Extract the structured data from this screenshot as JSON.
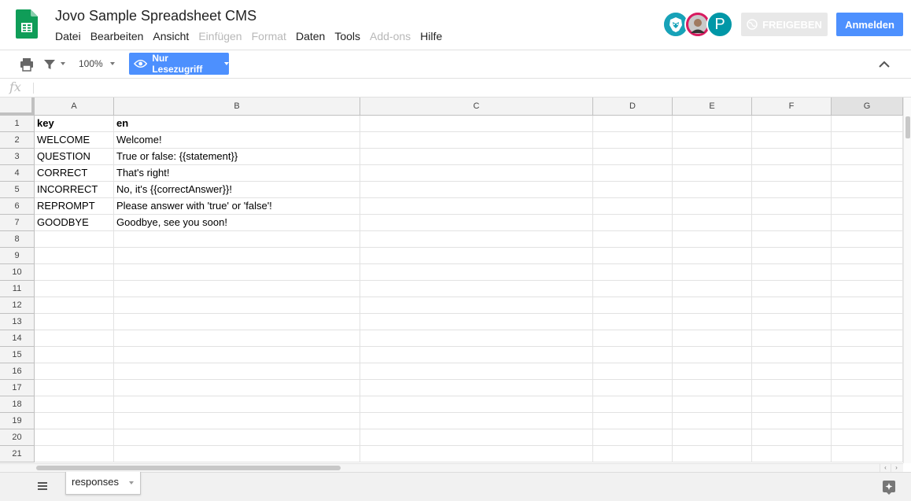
{
  "app": {
    "doc_title": "Jovo Sample Spreadsheet CMS",
    "brand_color": "#0f9d58"
  },
  "menu": [
    {
      "label": "Datei",
      "enabled": true
    },
    {
      "label": "Bearbeiten",
      "enabled": true
    },
    {
      "label": "Ansicht",
      "enabled": true
    },
    {
      "label": "Einfügen",
      "enabled": false
    },
    {
      "label": "Format",
      "enabled": false
    },
    {
      "label": "Daten",
      "enabled": true
    },
    {
      "label": "Tools",
      "enabled": true
    },
    {
      "label": "Add-ons",
      "enabled": false
    },
    {
      "label": "Hilfe",
      "enabled": true
    }
  ],
  "header": {
    "avatars": [
      "lion-avatar",
      "person-photo-avatar",
      "P"
    ],
    "share_label": "FREIGEBEN",
    "login_label": "Anmelden",
    "login_color": "#4d90fe"
  },
  "toolbar": {
    "icons": [
      "print-icon",
      "filter-icon",
      "chevron-up-icon"
    ],
    "zoom": "100%",
    "view_mode_label": "Nur Lesezugriff"
  },
  "formula_bar": {
    "fx_label": "fx",
    "value": ""
  },
  "grid": {
    "columns": [
      "A",
      "B",
      "C",
      "D",
      "E",
      "F",
      "G"
    ],
    "selected_column": "G",
    "rows": [
      {
        "num": "1",
        "cells": [
          "key",
          "en"
        ],
        "bold": true
      },
      {
        "num": "2",
        "cells": [
          "WELCOME",
          "Welcome!"
        ]
      },
      {
        "num": "3",
        "cells": [
          "QUESTION",
          "True or false: {{statement}}"
        ]
      },
      {
        "num": "4",
        "cells": [
          "CORRECT",
          "That's right!"
        ]
      },
      {
        "num": "5",
        "cells": [
          "INCORRECT",
          "No, it's {{correctAnswer}}!"
        ]
      },
      {
        "num": "6",
        "cells": [
          "REPROMPT",
          "Please answer with 'true' or 'false'!"
        ]
      },
      {
        "num": "7",
        "cells": [
          "GOODBYE",
          "Goodbye, see you soon!"
        ]
      },
      {
        "num": "8",
        "cells": []
      },
      {
        "num": "9",
        "cells": []
      },
      {
        "num": "10",
        "cells": []
      },
      {
        "num": "11",
        "cells": []
      },
      {
        "num": "12",
        "cells": []
      },
      {
        "num": "13",
        "cells": []
      },
      {
        "num": "14",
        "cells": []
      },
      {
        "num": "15",
        "cells": []
      },
      {
        "num": "16",
        "cells": []
      },
      {
        "num": "17",
        "cells": []
      },
      {
        "num": "18",
        "cells": []
      },
      {
        "num": "19",
        "cells": []
      },
      {
        "num": "20",
        "cells": []
      },
      {
        "num": "21",
        "cells": []
      }
    ]
  },
  "sheets": {
    "tabs": [
      "responses"
    ],
    "active": "responses"
  }
}
